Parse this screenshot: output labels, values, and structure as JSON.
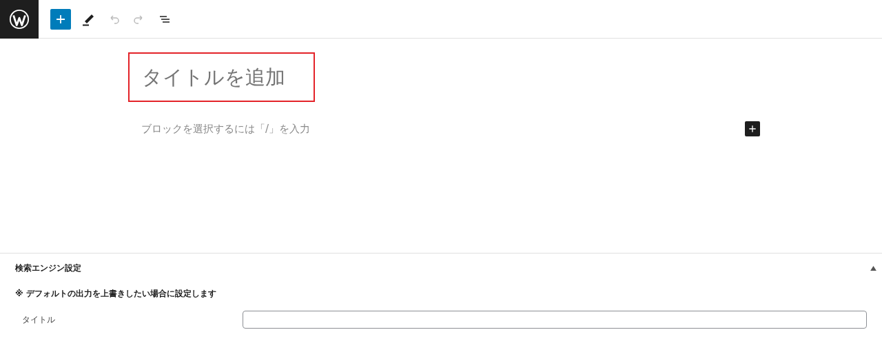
{
  "toolbar": {
    "buttons": [
      {
        "kind": "inserter",
        "disabled": false
      },
      {
        "kind": "tools",
        "disabled": false
      },
      {
        "kind": "undo",
        "disabled": true
      },
      {
        "kind": "redo",
        "disabled": true
      },
      {
        "kind": "list",
        "disabled": false
      }
    ]
  },
  "editor": {
    "title": {
      "placeholder": "タイトルを追加",
      "highlighted": true
    },
    "block": {
      "placeholder": "ブロックを選択するには「/」を入力"
    }
  },
  "panel": {
    "title": "検索エンジン設定",
    "expanded": true,
    "note": "※ デフォルトの出力を上書きしたい場合に設定します",
    "fields": [
      {
        "label": "タイトル"
      }
    ]
  }
}
